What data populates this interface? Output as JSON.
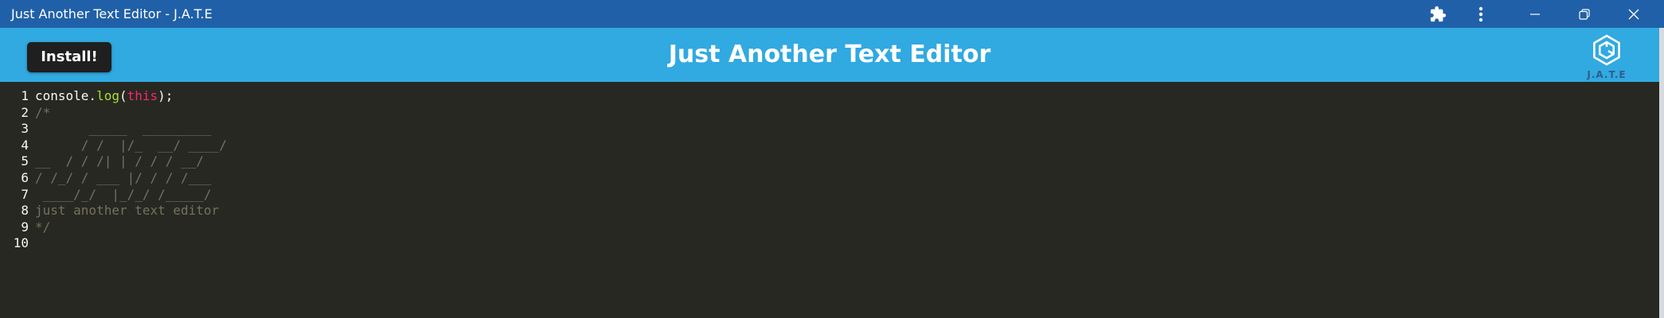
{
  "window": {
    "title": "Just Another Text Editor - J.A.T.E",
    "icons": {
      "extensions": "puzzle-icon",
      "more": "more-vertical-icon",
      "minimize": "minimize-icon",
      "restore": "restore-icon",
      "close": "close-icon"
    }
  },
  "header": {
    "install_label": "Install!",
    "title": "Just Another Text Editor",
    "logo_text": "J.A.T.E"
  },
  "colors": {
    "titlebar": "#2060a8",
    "header": "#31a9e1",
    "editor_bg": "#272822",
    "text": "#f8f8f2",
    "function": "#a6e22e",
    "keyword": "#f92672",
    "comment": "#75715e"
  },
  "editor": {
    "lines": [
      {
        "num": "1",
        "tokens": [
          {
            "text": "console.",
            "type": "plain"
          },
          {
            "text": "log",
            "type": "fn"
          },
          {
            "text": "(",
            "type": "plain"
          },
          {
            "text": "this",
            "type": "kw"
          },
          {
            "text": ");",
            "type": "plain"
          }
        ]
      },
      {
        "num": "2",
        "tokens": [
          {
            "text": "/*",
            "type": "comment"
          }
        ]
      },
      {
        "num": "3",
        "tokens": [
          {
            "text": "       _____  _________",
            "type": "comment"
          }
        ]
      },
      {
        "num": "4",
        "tokens": [
          {
            "text": "      / /  |/_  __/ ____/",
            "type": "comment"
          }
        ]
      },
      {
        "num": "5",
        "tokens": [
          {
            "text": "__  / / /| | / / / __/",
            "type": "comment"
          }
        ]
      },
      {
        "num": "6",
        "tokens": [
          {
            "text": "/ /_/ / ___ |/ / / /___",
            "type": "comment"
          }
        ]
      },
      {
        "num": "7",
        "tokens": [
          {
            "text": " ____/_/  |_/_/ /_____/",
            "type": "comment"
          }
        ]
      },
      {
        "num": "8",
        "tokens": [
          {
            "text": "just another text editor",
            "type": "comment"
          }
        ]
      },
      {
        "num": "9",
        "tokens": [
          {
            "text": "*/",
            "type": "comment"
          }
        ]
      },
      {
        "num": "10",
        "tokens": []
      }
    ]
  }
}
